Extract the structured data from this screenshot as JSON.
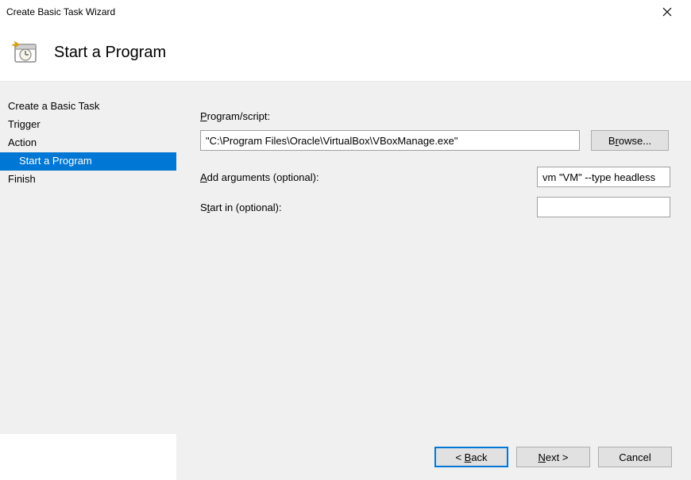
{
  "window": {
    "title": "Create Basic Task Wizard"
  },
  "header": {
    "title": "Start a Program"
  },
  "sidebar": {
    "items": [
      {
        "label": "Create a Basic Task",
        "selected": false,
        "indent": false
      },
      {
        "label": "Trigger",
        "selected": false,
        "indent": false
      },
      {
        "label": "Action",
        "selected": false,
        "indent": false
      },
      {
        "label": "Start a Program",
        "selected": true,
        "indent": true
      },
      {
        "label": "Finish",
        "selected": false,
        "indent": false
      }
    ]
  },
  "form": {
    "program_label": "Program/script:",
    "program_value": "\"C:\\Program Files\\Oracle\\VirtualBox\\VBoxManage.exe\"",
    "browse_label": "Browse...",
    "arguments_label": "Add arguments (optional):",
    "arguments_value": "vm \"VM\" --type headless",
    "startin_label": "Start in (optional):",
    "startin_value": ""
  },
  "footer": {
    "back_label": "< Back",
    "next_label": "Next >",
    "cancel_label": "Cancel"
  }
}
